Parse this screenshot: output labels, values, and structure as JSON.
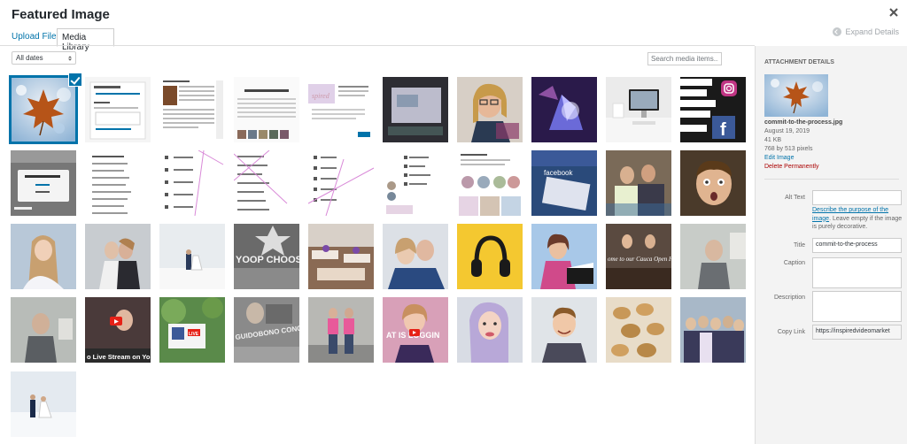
{
  "modal": {
    "title": "Featured Image",
    "close_icon": "close-icon"
  },
  "tabs": {
    "upload": "Upload Files",
    "library": "Media Library"
  },
  "expand_details": "Expand Details",
  "toolbar": {
    "date_filter": "All dates",
    "search_placeholder": "Search media items..."
  },
  "thumbnails": {
    "row3_text_1": "YOOP CHOOSE",
    "row4_text_1": "o Live Stream on Yo",
    "row4_text_2": "GUIDOBONO CONCRETE, INC",
    "row4_text_3": "AT IS LOGGIN",
    "row3_text_2": "ome to our Cauca Open House!",
    "facebook": "facebook",
    "live": "LIVE"
  },
  "attachment": {
    "heading": "ATTACHMENT DETAILS",
    "filename": "commit-to-the-process.jpg",
    "date": "August 19, 2019",
    "size": "41 KB",
    "dimensions": "768 by 513 pixels",
    "edit_link": "Edit Image",
    "delete_link": "Delete Permanently",
    "alt_label": "Alt Text",
    "alt_value": "",
    "help_link": "Describe the purpose of the image",
    "help_text": ". Leave empty if the image is purely decorative.",
    "title_label": "Title",
    "title_value": "commit-to-the-process",
    "caption_label": "Caption",
    "caption_value": "",
    "description_label": "Description",
    "description_value": "",
    "copy_link_label": "Copy Link",
    "copy_link_value": "https://inspiredvideomarket"
  },
  "colors": {
    "accent": "#0073aa",
    "delete": "#aa0000",
    "sidebar_bg": "#f3f3f3"
  }
}
